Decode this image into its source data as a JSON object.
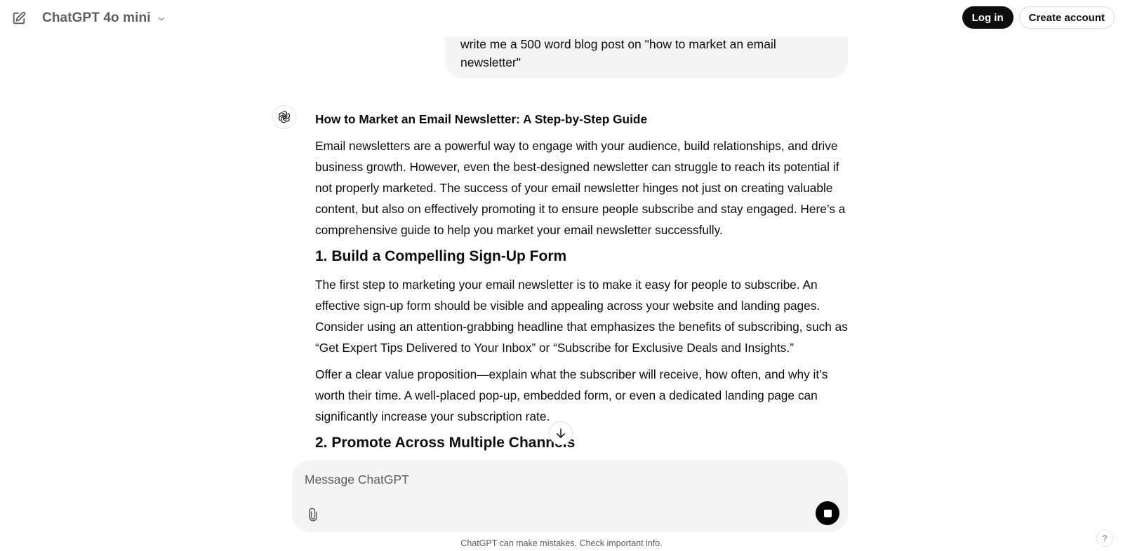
{
  "header": {
    "model_name": "ChatGPT 4o mini",
    "login_label": "Log in",
    "create_account_label": "Create account"
  },
  "conversation": {
    "user_message": "write me a 500 word blog post on \"how to market an email newsletter\"",
    "assistant": {
      "title": "How to Market an Email Newsletter: A Step-by-Step Guide",
      "intro": "Email newsletters are a powerful way to engage with your audience, build relationships, and drive business growth. However, even the best-designed newsletter can struggle to reach its potential if not properly marketed. The success of your email newsletter hinges not just on creating valuable content, but also on effectively promoting it to ensure people subscribe and stay engaged. Here’s a comprehensive guide to help you market your email newsletter successfully.",
      "section1_heading": "1. Build a Compelling Sign-Up Form",
      "section1_p1": "The first step to marketing your email newsletter is to make it easy for people to subscribe. An effective sign-up form should be visible and appealing across your website and landing pages. Consider using an attention-grabbing headline that emphasizes the benefits of subscribing, such as “Get Expert Tips Delivered to Your Inbox” or “Subscribe for Exclusive Deals and Insights.”",
      "section1_p2": "Offer a clear value proposition—explain what the subscriber will receive, how often, and why it’s worth their time. A well-placed pop-up, embedded form, or even a dedicated landing page can significantly increase your subscription rate.",
      "section2_heading": "2. Promote Across Multiple Channels"
    }
  },
  "composer": {
    "placeholder": "Message ChatGPT"
  },
  "footer": {
    "disclaimer": "ChatGPT can make mistakes. Check important info.",
    "help_label": "?"
  },
  "icons": {
    "new_chat": "edit-square-icon",
    "model_dropdown": "chevron-down-icon",
    "assistant_avatar": "openai-logo-icon",
    "scroll_down": "arrow-down-icon",
    "attach": "paperclip-icon",
    "stop": "stop-square-icon"
  },
  "colors": {
    "bubble_bg": "#f4f4f4",
    "primary_text": "#0d0d0d",
    "secondary_text": "#5d5d5d",
    "button_dark": "#0d0d0d"
  }
}
